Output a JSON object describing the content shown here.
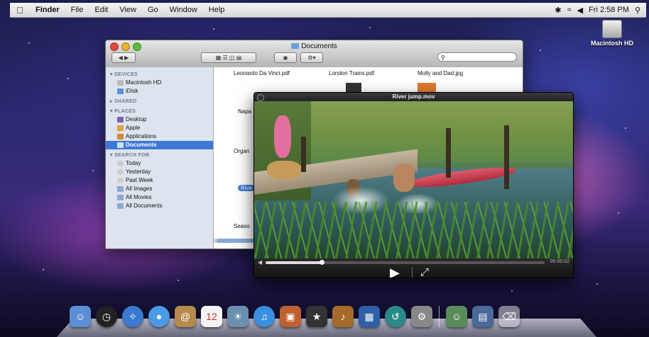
{
  "menubar": {
    "apple_icon": "apple-icon",
    "app": "Finder",
    "menus": [
      "File",
      "Edit",
      "View",
      "Go",
      "Window",
      "Help"
    ],
    "clock": "Fri 2:58 PM"
  },
  "desktop": {
    "hd_label": "Macintosh HD"
  },
  "finder": {
    "title": "Documents",
    "sidebar": {
      "devices_header": "DEVICES",
      "devices": [
        "Macintosh HD",
        "iDisk"
      ],
      "shared_header": "SHARED",
      "places_header": "PLACES",
      "places": [
        "Desktop",
        "Apple",
        "Applications",
        "Documents"
      ],
      "search_header": "SEARCH FOR",
      "search": [
        "Today",
        "Yesterday",
        "Past Week",
        "All Images",
        "All Movies",
        "All Documents"
      ]
    },
    "files": {
      "f1": "Leonardo Da Vinci.pdf",
      "f2": "London Trains.pdf",
      "f3": "Molly and Dad.jpg",
      "f4": "Napa",
      "f5": "Organ",
      "f6": "Rive",
      "f7": "Seaso"
    }
  },
  "quicktime": {
    "title": "River jump.mov",
    "timecode": "00:00:02",
    "progress": 0.2
  },
  "dock": {
    "items": [
      "finder-icon",
      "dashboard-icon",
      "safari-icon",
      "ichat-icon",
      "address-book-icon",
      "ical-icon",
      "iphoto-icon",
      "itunes-icon",
      "photo-booth-icon",
      "imovie-icon",
      "garageband-icon",
      "spaces-icon",
      "time-machine-icon",
      "system-preferences-icon",
      "photos-stack-icon",
      "documents-stack-icon",
      "trash-icon"
    ]
  }
}
